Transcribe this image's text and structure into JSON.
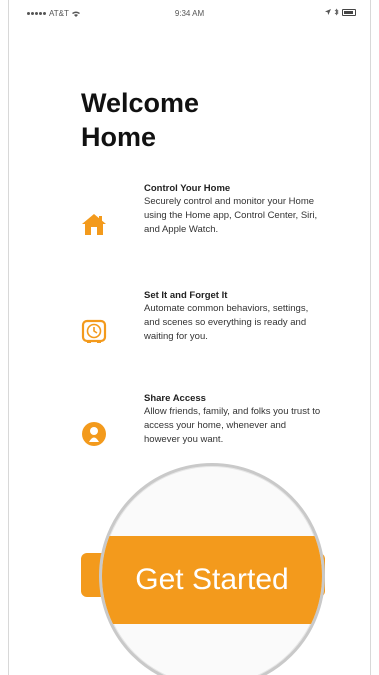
{
  "status_bar": {
    "carrier": "AT&T",
    "time": "9:34 AM"
  },
  "title": {
    "line1": "Welcome",
    "line2": "Home"
  },
  "features": [
    {
      "heading": "Control Your Home",
      "body": "Securely control and monitor your Home using the Home app, Control Center, Siri, and Apple Watch.",
      "icon": "house-icon"
    },
    {
      "heading": "Set It and Forget It",
      "body": "Automate common behaviors, settings, and scenes so everything is ready and waiting for you.",
      "icon": "clock-icon"
    },
    {
      "heading": "Share Access",
      "body": "Allow friends, family, and folks you trust to access your home, whenever and however you want.",
      "icon": "person-icon"
    }
  ],
  "button": {
    "label": "Get Started"
  },
  "colors": {
    "accent": "#f39a1c",
    "text": "#111111"
  }
}
